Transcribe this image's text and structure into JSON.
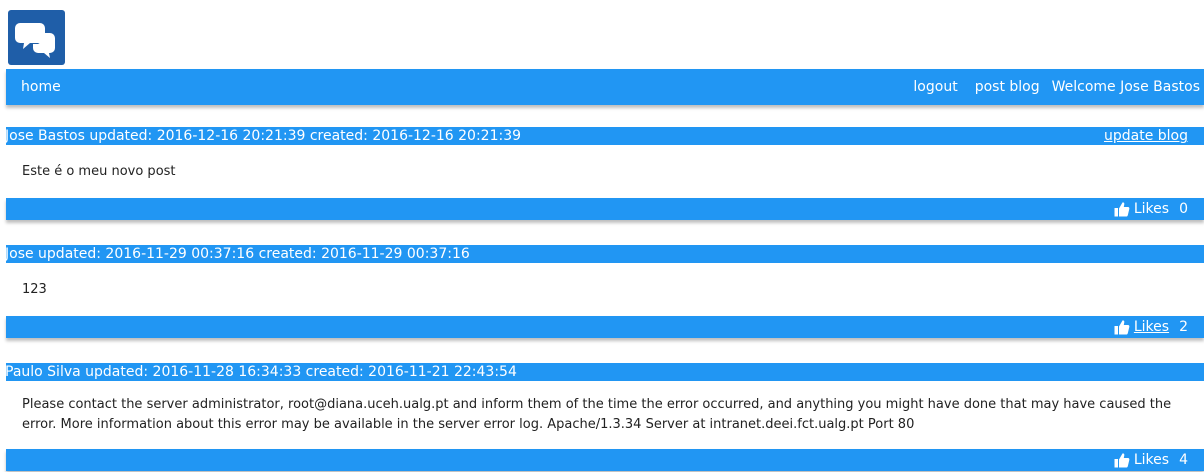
{
  "nav": {
    "home": "home",
    "logout": "logout",
    "post_blog": "post blog",
    "welcome": "Welcome Jose Bastos"
  },
  "posts": [
    {
      "header": "Jose Bastos updated: 2016-12-16 20:21:39 created: 2016-12-16 20:21:39",
      "update_link": "update blog",
      "body": "Este é o meu novo post",
      "likes_label": "Likes",
      "likes_count": "0"
    },
    {
      "header": "Jose updated: 2016-11-29 00:37:16 created: 2016-11-29 00:37:16",
      "body": "123",
      "likes_label": "Likes",
      "likes_count": "2"
    },
    {
      "header": "Paulo Silva updated: 2016-11-28 16:34:33 created: 2016-11-21 22:43:54",
      "body": "Please contact the server administrator, root@diana.uceh.ualg.pt and inform them of the time the error occurred, and anything you might have done that may have caused the error. More information about this error may be available in the server error log. Apache/1.3.34 Server at intranet.deei.fct.ualg.pt Port 80",
      "likes_label": "Likes",
      "likes_count": "4"
    }
  ],
  "icons": {
    "logo": "chat-bubbles-icon",
    "like": "thumbs-up-icon"
  },
  "colors": {
    "primary": "#2196f3",
    "logo_bg": "#1f5ea8"
  }
}
